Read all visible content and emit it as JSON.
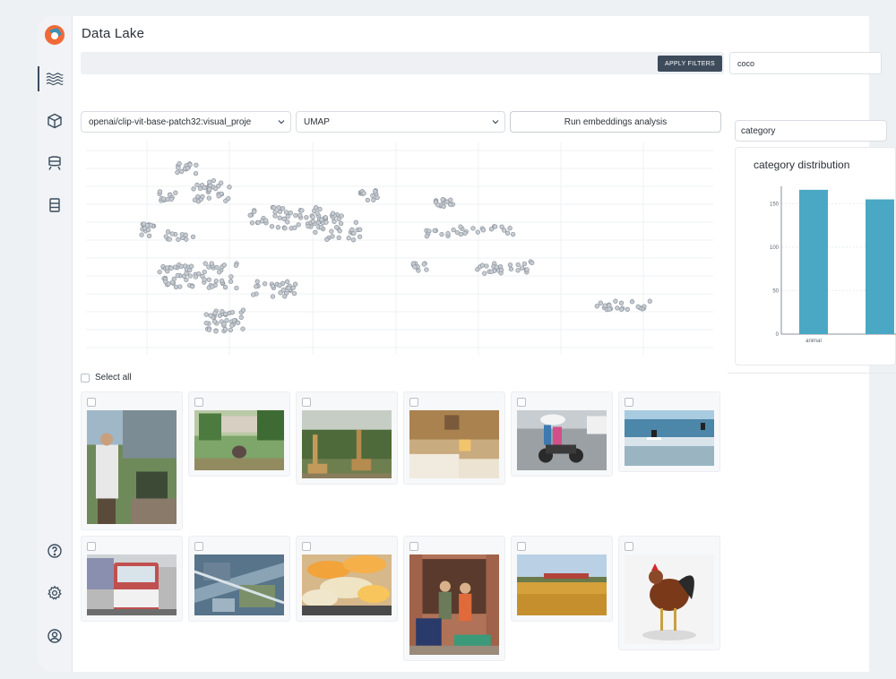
{
  "app": {
    "title": "Data Lake"
  },
  "sidebar": {
    "items": [
      {
        "icon": "waves-icon",
        "active": true
      },
      {
        "icon": "cube-icon"
      },
      {
        "icon": "train-icon"
      },
      {
        "icon": "list-icon"
      }
    ],
    "bottom_items": [
      {
        "icon": "help-icon"
      },
      {
        "icon": "settings-icon"
      },
      {
        "icon": "account-icon"
      }
    ]
  },
  "filters": {
    "apply_label": "APPLY FILTERS",
    "search_value": "coco"
  },
  "embeddings": {
    "model_value": "openai/clip-vit-base-patch32:visual_proje",
    "method_value": "UMAP",
    "run_label": "Run embeddings analysis"
  },
  "grid": {
    "select_all_label": "Select all",
    "images": [
      {
        "subject": "man with camera on street"
      },
      {
        "subject": "park with elephant"
      },
      {
        "subject": "giraffes in zoo"
      },
      {
        "subject": "hotel room with beds"
      },
      {
        "subject": "people on motorbike with umbrella"
      },
      {
        "subject": "surfers in waves"
      },
      {
        "subject": "red and white bus"
      },
      {
        "subject": "aerial view of city"
      },
      {
        "subject": "orange pastries on plate"
      },
      {
        "subject": "two women with luggage"
      },
      {
        "subject": "train crossing farm field"
      },
      {
        "subject": "rooster standing"
      }
    ]
  },
  "distribution": {
    "field_value": "category",
    "title": "category distribution",
    "chart_data": {
      "type": "bar",
      "categories": [
        "animal",
        ""
      ],
      "values": [
        166,
        155
      ],
      "y_ticks": [
        "150",
        "100",
        "50",
        "0"
      ],
      "colors": {
        "bar": "#4aa8c4"
      }
    }
  }
}
